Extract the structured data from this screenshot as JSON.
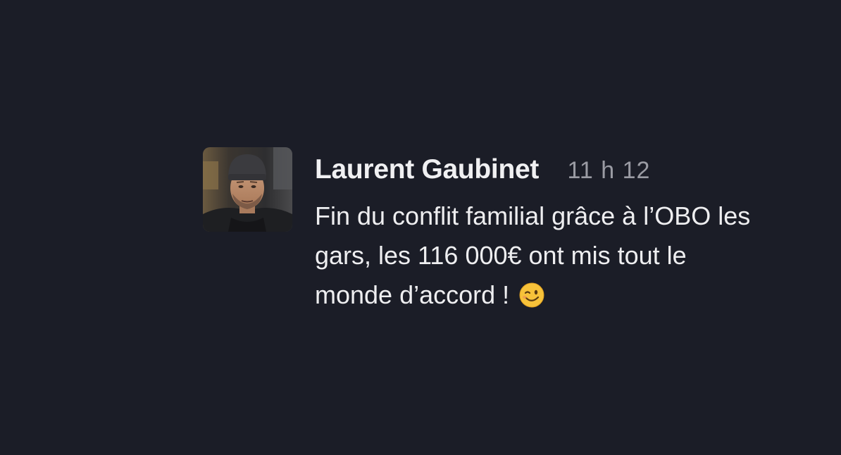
{
  "message": {
    "author": "Laurent Gaubinet",
    "timestamp": "11 h 12",
    "lines": [
      "Fin du conflit familial grâce à l’OBO les",
      "gars, les 116 000€ ont mis tout le",
      "monde d’accord !"
    ],
    "emoji": "winking-face"
  },
  "colors": {
    "background": "#1b1d27",
    "author": "#f0f0f2",
    "timestamp": "#9a9ba3",
    "text": "#eeeef0"
  }
}
